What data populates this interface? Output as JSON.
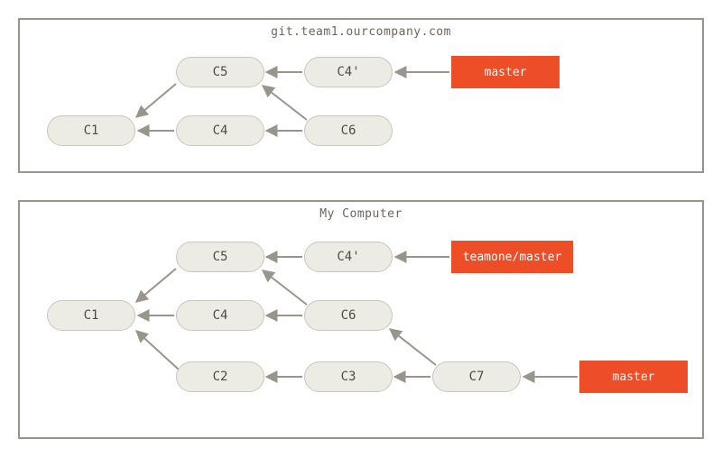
{
  "panels": {
    "remote": {
      "title": "git.team1.ourcompany.com"
    },
    "local": {
      "title": "My Computer"
    }
  },
  "commits": {
    "r_c1": "C1",
    "r_c5": "C5",
    "r_c4": "C4",
    "r_c4p": "C4'",
    "r_c6": "C6",
    "l_c1": "C1",
    "l_c5": "C5",
    "l_c4": "C4",
    "l_c4p": "C4'",
    "l_c6": "C6",
    "l_c2": "C2",
    "l_c3": "C3",
    "l_c7": "C7"
  },
  "refs": {
    "r_master": "master",
    "l_teamone": "teamone/master",
    "l_master": "master"
  }
}
